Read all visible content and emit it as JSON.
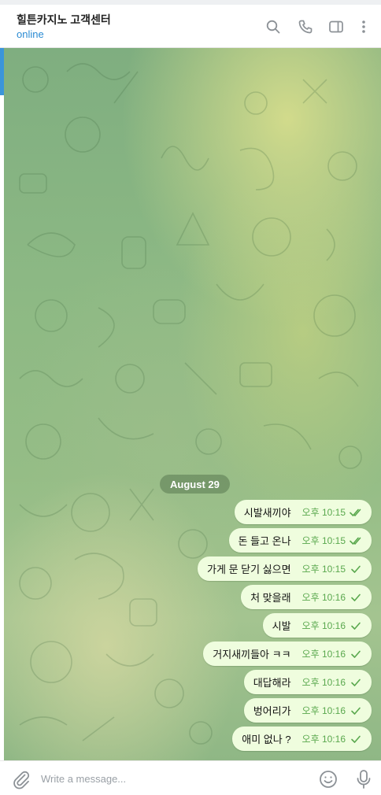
{
  "header": {
    "title": "힐튼카지노 고객센터",
    "status": "online",
    "icons": [
      "search-icon",
      "phone-icon",
      "sidebar-panel-icon",
      "more-vertical-icon"
    ]
  },
  "chat": {
    "date_label": "August 29",
    "messages": [
      {
        "text": "시발새끼야",
        "time": "오후 10:15",
        "status": "read"
      },
      {
        "text": "돈 들고 온나",
        "time": "오후 10:15",
        "status": "read"
      },
      {
        "text": "가게 문 닫기 싫으면",
        "time": "오후 10:15",
        "status": "sent"
      },
      {
        "text": "처 맞을래",
        "time": "오후 10:16",
        "status": "sent"
      },
      {
        "text": "시발",
        "time": "오후 10:16",
        "status": "sent"
      },
      {
        "text": "거지새끼들아 ㅋㅋ",
        "time": "오후 10:16",
        "status": "sent"
      },
      {
        "text": "대답해라",
        "time": "오후 10:16",
        "status": "sent"
      },
      {
        "text": "벙어리가",
        "time": "오후 10:16",
        "status": "sent"
      },
      {
        "text": "애미 없나 ?",
        "time": "오후 10:16",
        "status": "sent"
      }
    ]
  },
  "composer": {
    "placeholder": "Write a message...",
    "icons": [
      "attach-icon",
      "emoji-icon",
      "microphone-icon"
    ]
  },
  "colors": {
    "accent": "#2a8bd3",
    "bubble": "#effdde",
    "time": "#5aa84e"
  }
}
